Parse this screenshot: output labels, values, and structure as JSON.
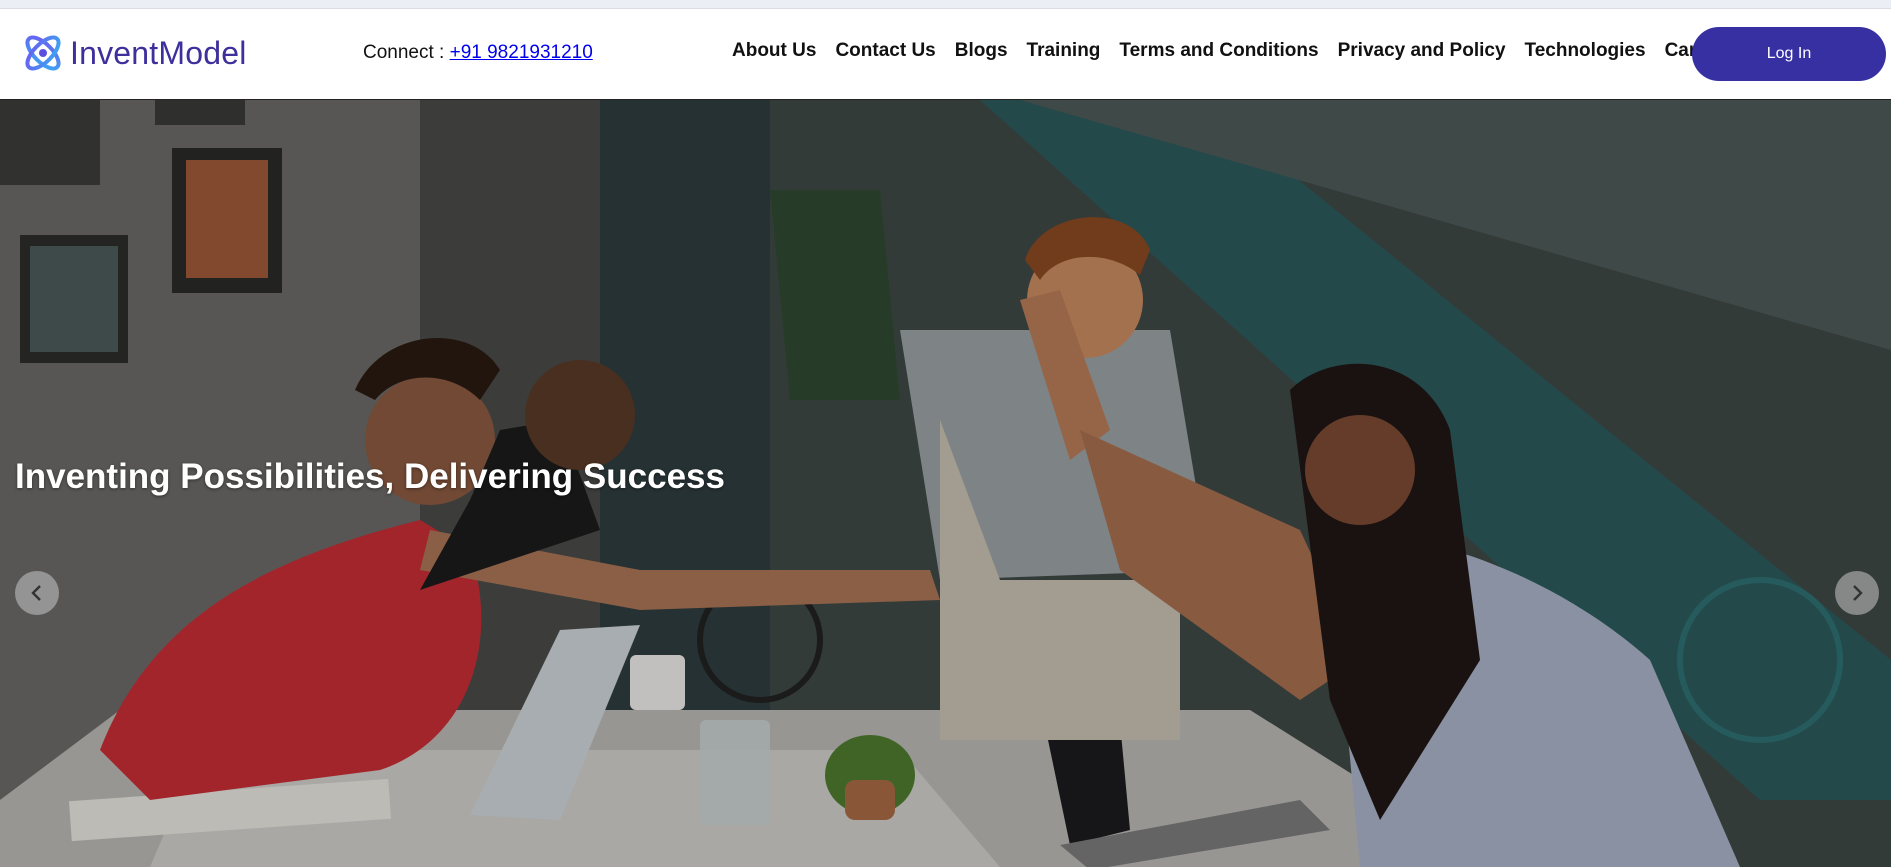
{
  "brand": {
    "name": "InventModel",
    "accent": "#3d2f9c",
    "logo_icon": "atom-logo-icon"
  },
  "header": {
    "connect_label": "Connect : ",
    "phone": "+91 9821931210",
    "nav": [
      "About Us",
      "Contact Us",
      "Blogs",
      "Training",
      "Terms and Conditions",
      "Privacy and Policy",
      "Technologies",
      "Career"
    ],
    "login_label": "Log In",
    "login_color": "#3730a3"
  },
  "hero": {
    "title": "Inventing Possibilities, Delivering Success",
    "prev_icon": "chevron-left-icon",
    "next_icon": "chevron-right-icon"
  }
}
